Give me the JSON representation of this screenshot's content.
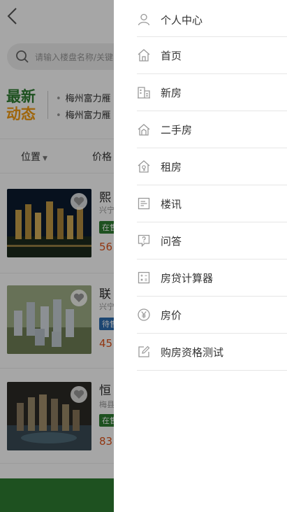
{
  "header": {
    "back_icon": "chevron-left-icon"
  },
  "search": {
    "placeholder": "请输入楼盘名称/关键"
  },
  "news": {
    "logo_line1": "最新",
    "logo_line2": "动态",
    "items": [
      "梅州富力雁",
      "梅州富力雁"
    ]
  },
  "filters": [
    "位置",
    "价格"
  ],
  "listings": [
    {
      "name": "熙",
      "sub": "兴宁",
      "tag": "在售",
      "tag_color": "#2e7d32",
      "price": "56"
    },
    {
      "name": "联",
      "sub": "兴宁",
      "tag": "待售",
      "tag_color": "#2b6cb0",
      "price": "45"
    },
    {
      "name": "恒",
      "sub": "梅县",
      "tag": "在售",
      "tag_color": "#2e7d32",
      "price": "83"
    }
  ],
  "drawer": {
    "items": [
      {
        "label": "个人中心",
        "icon": "user-icon"
      },
      {
        "label": "首页",
        "icon": "home-icon"
      },
      {
        "label": "新房",
        "icon": "building-icon"
      },
      {
        "label": "二手房",
        "icon": "house-icon"
      },
      {
        "label": "租房",
        "icon": "rent-house-icon"
      },
      {
        "label": "楼讯",
        "icon": "news-doc-icon"
      },
      {
        "label": "问答",
        "icon": "question-chat-icon"
      },
      {
        "label": "房贷计算器",
        "icon": "calculator-icon"
      },
      {
        "label": "房价",
        "icon": "yen-circle-icon"
      },
      {
        "label": "购房资格测试",
        "icon": "edit-icon"
      }
    ]
  },
  "colors": {
    "brand_green": "#2e7d32",
    "accent_orange": "#f39c12",
    "price_red": "#e0541b"
  }
}
